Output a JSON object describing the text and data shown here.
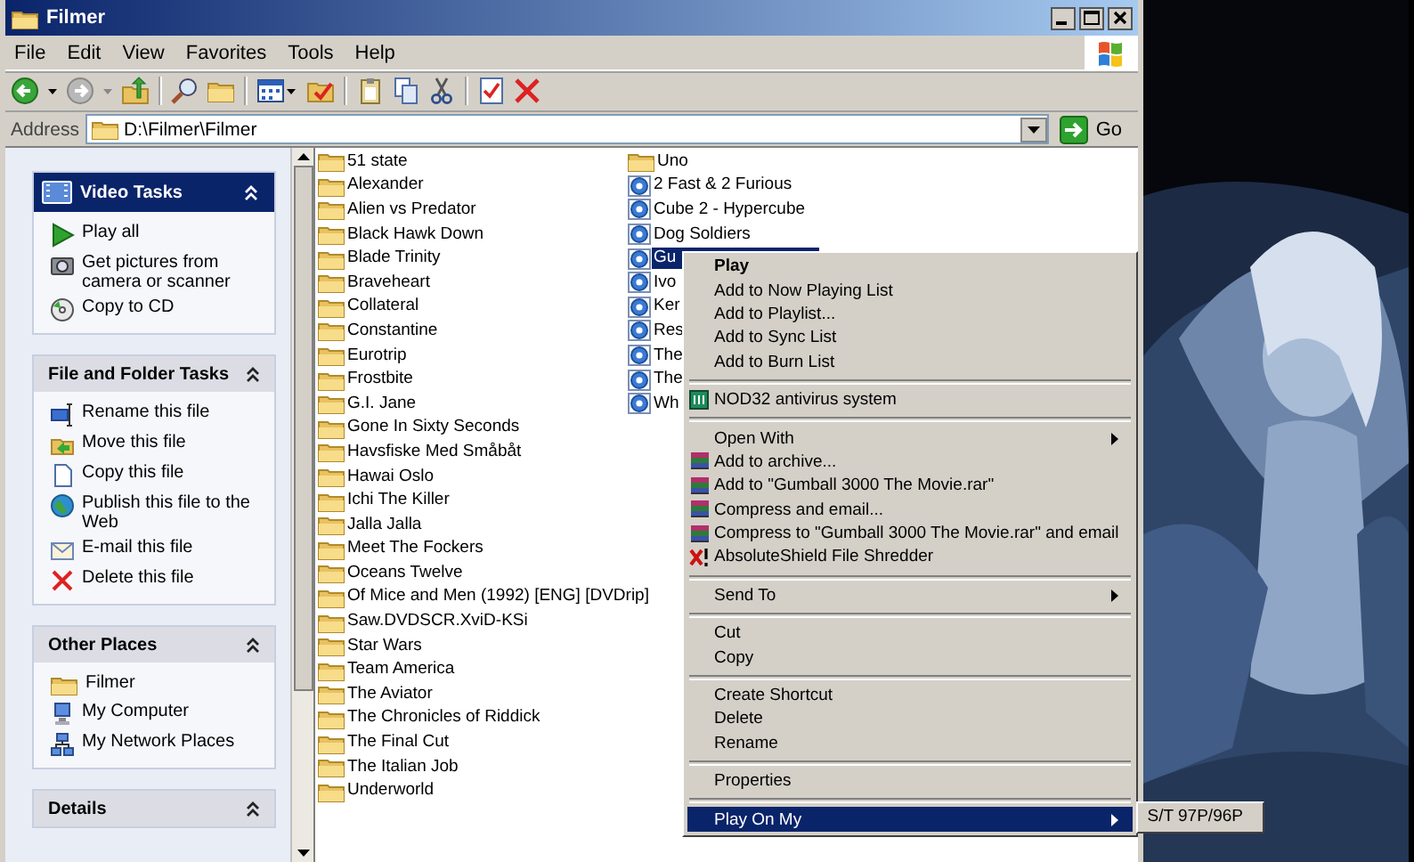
{
  "window": {
    "title": "Filmer"
  },
  "menu_bar": [
    "File",
    "Edit",
    "View",
    "Favorites",
    "Tools",
    "Help"
  ],
  "address_bar": {
    "label": "Address",
    "value": "D:\\Filmer\\Filmer",
    "go": "Go"
  },
  "task_panes": [
    {
      "title": "Video Tasks",
      "kind": "primary",
      "items": [
        {
          "label": "Play all"
        },
        {
          "label": "Get pictures from camera or scanner"
        },
        {
          "label": "Copy to CD"
        }
      ]
    },
    {
      "title": "File and Folder Tasks",
      "kind": "normal",
      "items": [
        {
          "label": "Rename this file"
        },
        {
          "label": "Move this file"
        },
        {
          "label": "Copy this file"
        },
        {
          "label": "Publish this file to the Web"
        },
        {
          "label": "E-mail this file"
        },
        {
          "label": "Delete this file"
        }
      ]
    },
    {
      "title": "Other Places",
      "kind": "normal",
      "items": [
        {
          "label": "Filmer"
        },
        {
          "label": "My Computer"
        },
        {
          "label": "My Network Places"
        }
      ]
    },
    {
      "title": "Details",
      "kind": "normal"
    }
  ],
  "files": {
    "columns": [
      [
        {
          "name": "51 state",
          "kind": "folder",
          "selected": false
        },
        {
          "name": "Alexander",
          "kind": "folder",
          "selected": false
        },
        {
          "name": "Alien vs Predator",
          "kind": "folder",
          "selected": false
        },
        {
          "name": "Black Hawk Down",
          "kind": "folder",
          "selected": false
        },
        {
          "name": "Blade Trinity",
          "kind": "folder",
          "selected": false
        },
        {
          "name": "Braveheart",
          "kind": "folder",
          "selected": false
        },
        {
          "name": "Collateral",
          "kind": "folder",
          "selected": false
        },
        {
          "name": "Constantine",
          "kind": "folder",
          "selected": false
        },
        {
          "name": "Eurotrip",
          "kind": "folder",
          "selected": false
        },
        {
          "name": "Frostbite",
          "kind": "folder",
          "selected": false
        },
        {
          "name": "G.I. Jane",
          "kind": "folder",
          "selected": false
        },
        {
          "name": "Gone In Sixty Seconds",
          "kind": "folder",
          "selected": false
        },
        {
          "name": "Havsfiske Med Småbåt",
          "kind": "folder",
          "selected": false
        },
        {
          "name": "Hawai Oslo",
          "kind": "folder",
          "selected": false
        },
        {
          "name": "Ichi The Killer",
          "kind": "folder",
          "selected": false
        },
        {
          "name": "Jalla Jalla",
          "kind": "folder",
          "selected": false
        },
        {
          "name": "Meet The Fockers",
          "kind": "folder",
          "selected": false
        },
        {
          "name": "Oceans Twelve",
          "kind": "folder",
          "selected": false
        },
        {
          "name": "Of Mice and Men (1992) [ENG] [DVDrip]",
          "kind": "folder",
          "selected": false
        },
        {
          "name": "Saw.DVDSCR.XviD-KSi",
          "kind": "folder",
          "selected": false
        },
        {
          "name": "Star Wars",
          "kind": "folder",
          "selected": false
        },
        {
          "name": "Team America",
          "kind": "folder",
          "selected": false
        },
        {
          "name": "The Aviator",
          "kind": "folder",
          "selected": false
        },
        {
          "name": "The Chronicles of Riddick",
          "kind": "folder",
          "selected": false
        },
        {
          "name": "The Final Cut",
          "kind": "folder",
          "selected": false
        },
        {
          "name": "The Italian Job",
          "kind": "folder",
          "selected": false
        },
        {
          "name": "Underworld",
          "kind": "folder",
          "selected": false
        }
      ],
      [
        {
          "name": "Uno",
          "kind": "folder",
          "selected": false
        },
        {
          "name": "2 Fast & 2 Furious",
          "kind": "video",
          "selected": false
        },
        {
          "name": "Cube 2 - Hypercube",
          "kind": "video",
          "selected": false
        },
        {
          "name": "Dog Soldiers",
          "kind": "video",
          "selected": false
        },
        {
          "name": "Gu",
          "kind": "video",
          "selected": true
        },
        {
          "name": "Ivo",
          "kind": "video",
          "selected": false
        },
        {
          "name": "Ker",
          "kind": "video",
          "selected": false
        },
        {
          "name": "Res",
          "kind": "video",
          "selected": false
        },
        {
          "name": "The",
          "kind": "video",
          "selected": false
        },
        {
          "name": "The",
          "kind": "video",
          "selected": false
        },
        {
          "name": "Wh",
          "kind": "video",
          "selected": false
        }
      ]
    ]
  },
  "context_menu": {
    "items": [
      {
        "kind": "plain",
        "label": "Play",
        "default": true,
        "selected": false
      },
      {
        "kind": "plain",
        "label": "Add to Now Playing List",
        "default": false,
        "selected": false
      },
      {
        "kind": "plain",
        "label": "Add to Playlist...",
        "default": false,
        "selected": false
      },
      {
        "kind": "plain",
        "label": "Add to Sync List",
        "default": false,
        "selected": false
      },
      {
        "kind": "plain",
        "label": "Add to Burn List",
        "default": false,
        "selected": false
      },
      {
        "kind": "separator"
      },
      {
        "kind": "scanner",
        "label": "NOD32 antivirus system",
        "default": false,
        "selected": false
      },
      {
        "kind": "separator"
      },
      {
        "kind": "submenu",
        "label": "Open With",
        "default": false,
        "selected": false
      },
      {
        "kind": "archive",
        "label": "Add to archive...",
        "default": false,
        "selected": false
      },
      {
        "kind": "archive",
        "label": "Add to \"Gumball 3000 The Movie.rar\"",
        "default": false,
        "selected": false
      },
      {
        "kind": "archive",
        "label": "Compress and email...",
        "default": false,
        "selected": false
      },
      {
        "kind": "archive",
        "label": "Compress to \"Gumball 3000 The Movie.rar\" and email",
        "default": false,
        "selected": false
      },
      {
        "kind": "shredder",
        "label": "AbsoluteShield File Shredder",
        "default": false,
        "selected": false
      },
      {
        "kind": "separator"
      },
      {
        "kind": "submenu",
        "label": "Send To",
        "default": false,
        "selected": false
      },
      {
        "kind": "separator"
      },
      {
        "kind": "plain",
        "label": "Cut",
        "default": false,
        "selected": false
      },
      {
        "kind": "plain",
        "label": "Copy",
        "default": false,
        "selected": false
      },
      {
        "kind": "separator"
      },
      {
        "kind": "plain",
        "label": "Create Shortcut",
        "default": false,
        "selected": false
      },
      {
        "kind": "plain",
        "label": "Delete",
        "default": false,
        "selected": false
      },
      {
        "kind": "plain",
        "label": "Rename",
        "default": false,
        "selected": false
      },
      {
        "kind": "separator"
      },
      {
        "kind": "plain",
        "label": "Properties",
        "default": false,
        "selected": false
      },
      {
        "kind": "separator"
      },
      {
        "kind": "submenu",
        "label": "Play On My",
        "default": false,
        "selected": true
      }
    ]
  },
  "submenu": {
    "items": [
      {
        "label": "S/T 97P/96P"
      }
    ]
  }
}
